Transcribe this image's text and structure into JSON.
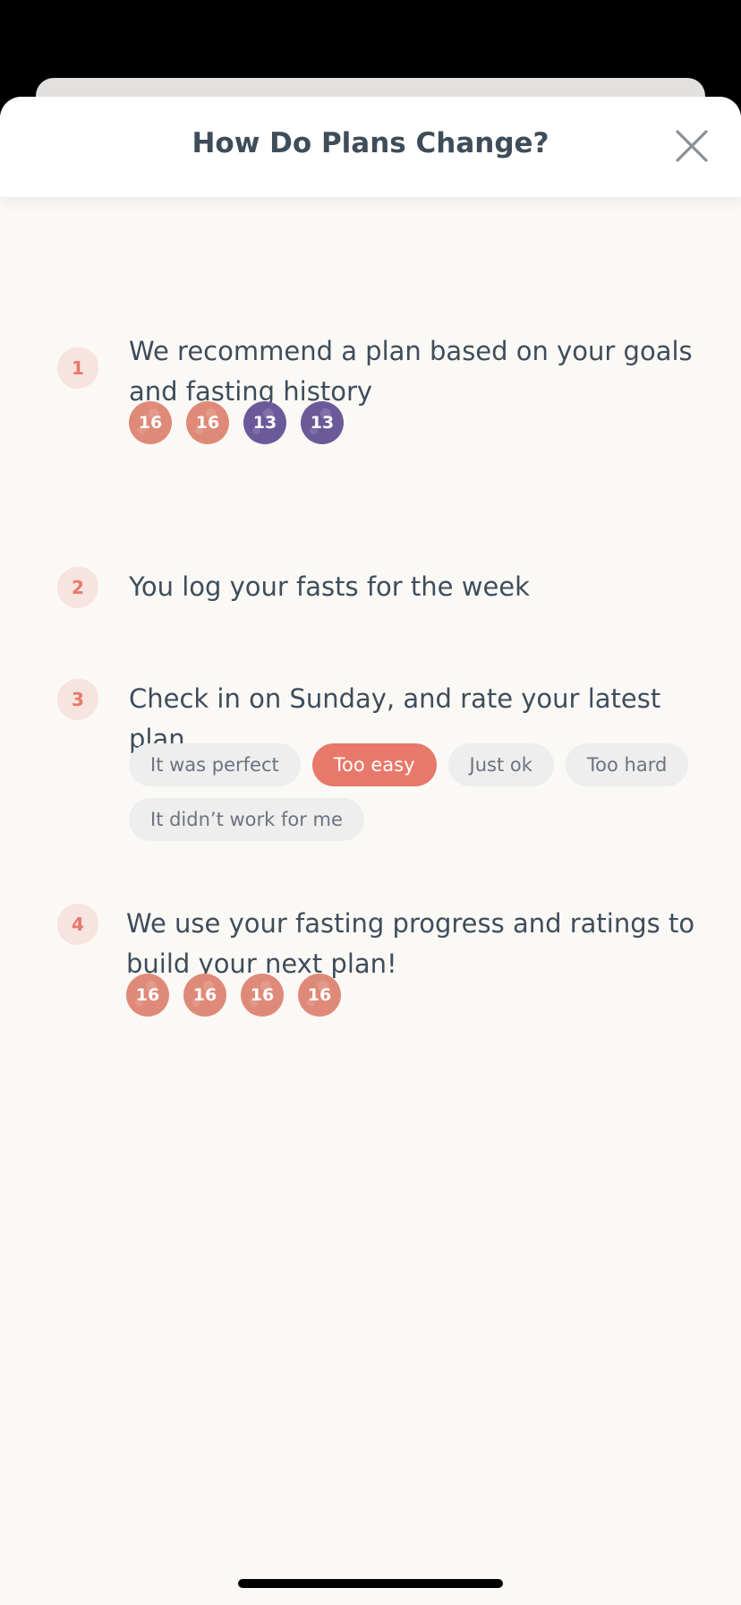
{
  "header": {
    "title": "How Do Plans Change?"
  },
  "colors": {
    "accent": "#e8786a",
    "coral_circle": "#df8a78",
    "purple_circle": "#6b5a9a",
    "text": "#3f4d5a",
    "chip_bg": "#eeeeee",
    "sheet_bg": "#fbf9f6"
  },
  "steps": [
    {
      "number": "1",
      "text": "We recommend a plan based on your goals and fasting history",
      "circles": [
        {
          "value": "16",
          "color": "#df8a78"
        },
        {
          "value": "16",
          "color": "#df8a78"
        },
        {
          "value": "13",
          "color": "#6b5a9a"
        },
        {
          "value": "13",
          "color": "#6b5a9a"
        }
      ]
    },
    {
      "number": "2",
      "text": "You log your fasts for the week"
    },
    {
      "number": "3",
      "text": "Check in on Sunday, and rate your latest plan",
      "chips": [
        {
          "label": "It was perfect",
          "selected": false
        },
        {
          "label": "Too easy",
          "selected": true
        },
        {
          "label": "Just ok",
          "selected": false
        },
        {
          "label": "Too hard",
          "selected": false
        },
        {
          "label": "It didn’t work for me",
          "selected": false
        }
      ]
    },
    {
      "number": "4",
      "text": "We use your fasting progress and ratings to build your next plan!",
      "circles": [
        {
          "value": "16",
          "color": "#df8a78"
        },
        {
          "value": "16",
          "color": "#df8a78"
        },
        {
          "value": "16",
          "color": "#df8a78"
        },
        {
          "value": "16",
          "color": "#df8a78"
        }
      ]
    }
  ],
  "icons": {
    "close": "close-icon"
  }
}
